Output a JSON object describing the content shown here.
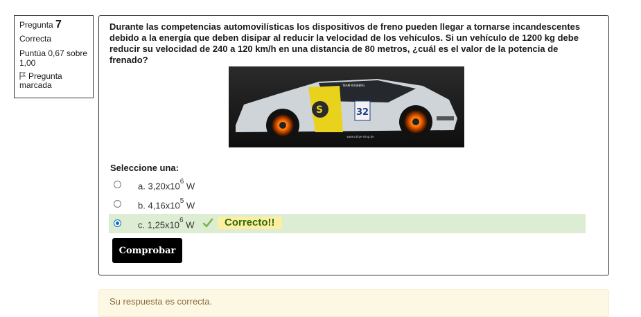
{
  "info": {
    "question_label": "Pregunta",
    "question_number": "7",
    "state": "Correcta",
    "grade": "Puntúa 0,67 sobre 1,00",
    "flag_label": "Pregunta marcada"
  },
  "question": {
    "text": "Durante las competencias automovilísticas los dispositivos de freno pueden llegar a tornarse incandescentes debido a la energía que deben disipar al reducir la velocidad de los vehículos.  Si un vehículo de 1200 kg debe reducir su velocidad de 240 a 120 km/h en una distancia de 80 metros, ¿cuál es el valor de la potencia de frenado?",
    "image": {
      "car_number": "32",
      "sponsor_text": "www.rallye-shop.de",
      "team_text": "TEAM ROSBERG"
    },
    "prompt": "Seleccione una:",
    "answers": [
      {
        "letter": "a.",
        "value": "3,20x10",
        "exp": "6",
        "unit": "W",
        "selected": false
      },
      {
        "letter": "b.",
        "value": "4,16x10",
        "exp": "5",
        "unit": "W",
        "selected": false
      },
      {
        "letter": "c.",
        "value": "1,25x10",
        "exp": "6",
        "unit": "W",
        "selected": true
      }
    ],
    "feedback": "Correcto!!",
    "submit_label": "Comprobar"
  },
  "outcome": {
    "text": "Su respuesta es correcta."
  },
  "colors": {
    "correct_bg": "#dcedd4",
    "feedback_bg": "#fcefa1",
    "feedback_text": "#2e6b0e",
    "check": "#7cb342",
    "radio": "#0f6cbf",
    "outcome_bg": "#fcf8e3"
  }
}
